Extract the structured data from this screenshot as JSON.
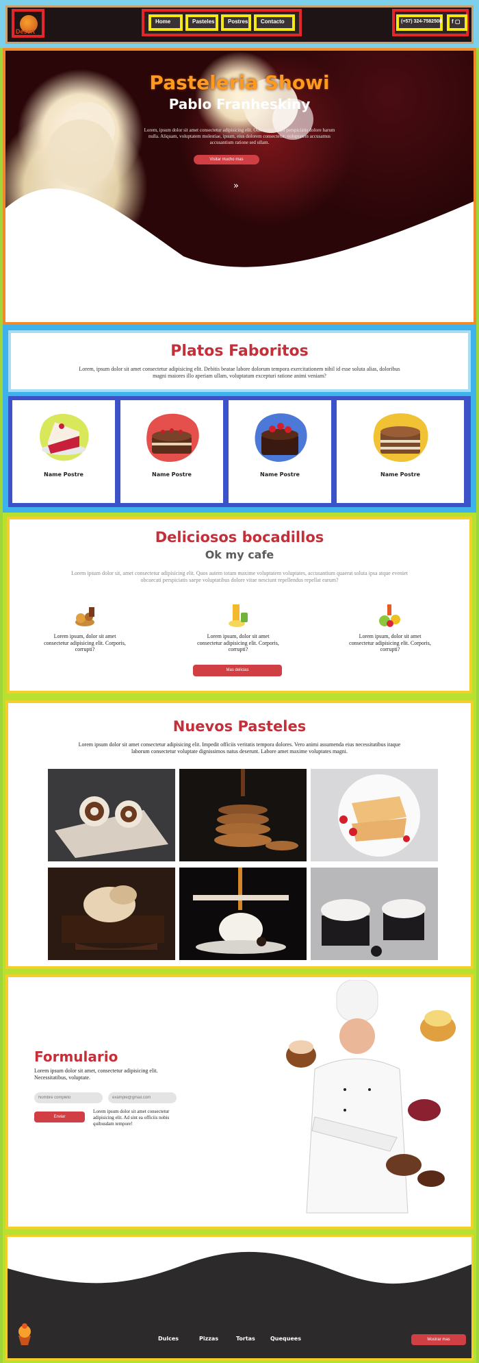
{
  "nav": {
    "logo_text": "Desert",
    "links": [
      "Home",
      "Pasteles",
      "Postres",
      "Contacto"
    ],
    "phone": "(+57) 324-7582508",
    "social_icons": [
      "facebook-icon",
      "instagram-icon"
    ]
  },
  "hero": {
    "brand": "Pasteleria Showi",
    "owner": "Pablo Franheskiny",
    "text": "Lorem, ipsum dolor sit amet consectetur adipisicing elit. Odit voluptatum perspiciatis dolore harum nulla. Aliquam, voluptatem molestiae, ipsum, eius dolorem consectetur, voluptatem accusamus accusantium ratione sed ullam.",
    "button": "Visitar mucho mas",
    "chevron_icon": "double-chevron-down-icon"
  },
  "favorites": {
    "title": "Platos Faboritos",
    "text": "Lorem, ipsum dolor sit amet consectetur adipisicing elit. Debitis beatae labore dolorum tempora exercitationem nihil id esse soluta alias, doloribus magni maiores illo aperiam ullam, voluptatum excepturi ratione animi veniam?",
    "cards": [
      {
        "name": "Name Postre",
        "blob": "#d8e85a"
      },
      {
        "name": "Name Postre",
        "blob": "#e6504c"
      },
      {
        "name": "Name Postre",
        "blob": "#4c78d8"
      },
      {
        "name": "Name Postre",
        "blob": "#f0c234"
      }
    ]
  },
  "snacks": {
    "title": "Deliciosos bocadillos",
    "subtitle": "Ok my cafe",
    "text": "Lorem ipsum dolor sit, amet consectetur adipisicing elit. Quos autem totam maxime voluptatem voluptates, accusantium quaerat soluta ipsa atque eveniet obcaecati perspiciatis saepe voluptatibus dolore vitae nesciunt repellendus repellat earum?",
    "items": [
      {
        "text": "Lorem ipsum, dolor sit amet consectetur adipisicing elit. Corporis, corrupti?"
      },
      {
        "text": "Lorem ipsum, dolor sit amet consectetur adipisicing elit. Corporis, corrupti?"
      },
      {
        "text": "Lorem ipsum, dolor sit amet consectetur adipisicing elit. Corporis, corrupti?"
      }
    ],
    "button": "Mas delicias"
  },
  "new_cakes": {
    "title": "Nuevos Pasteles",
    "text": "Lorem ipsum dolor sit amet consectetur adipisicing elit. Impedit officiis veritatis tempora dolores. Vero animi assumenda eius necessitatibus itaque laborum consectetur voluptate dignissimos natus deserunt. Labore amet maxime voluptates magni."
  },
  "form": {
    "title": "Formulario",
    "text": "Lorem ipsum dolor sit amet, consectetur adipisicing elit. Necessitatibus, voluptate.",
    "name_placeholder": "Nombre completo",
    "email_placeholder": "example@gmail.com",
    "button": "Enviar",
    "note": "Lorem ipsum dolor sit amet consectetur adipisicing elit. Ad sint ea officiis nobis quibusdam tempore!"
  },
  "footer": {
    "links": [
      "Dulces",
      "Pizzas",
      "Tortas",
      "Quequees"
    ],
    "button": "Mostrar mas"
  },
  "colors": {
    "accent_red": "#c3303a",
    "button_red": "#cf3f44",
    "brand_orange": "#ff9a1f",
    "footer_bg": "#2c2a2a"
  }
}
